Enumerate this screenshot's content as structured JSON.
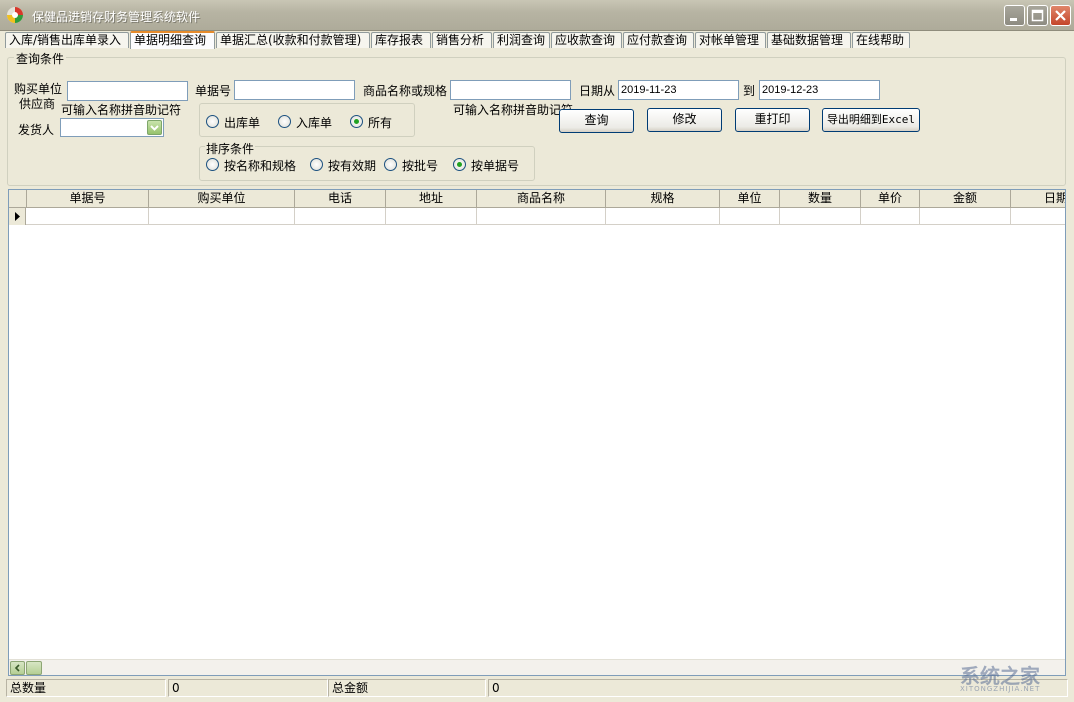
{
  "window": {
    "title": "保健品进销存财务管理系统软件"
  },
  "tabs": [
    {
      "label": "入库/销售出库单录入"
    },
    {
      "label": "单据明细查询"
    },
    {
      "label": "单据汇总(收款和付款管理)"
    },
    {
      "label": "库存报表"
    },
    {
      "label": "销售分析"
    },
    {
      "label": "利润查询"
    },
    {
      "label": "应收款查询"
    },
    {
      "label": "应付款查询"
    },
    {
      "label": "对帐单管理"
    },
    {
      "label": "基础数据管理"
    },
    {
      "label": "在线帮助"
    }
  ],
  "query": {
    "legend": "查询条件",
    "buyer_label": "购买单位",
    "supplier_label": "供应商",
    "pinyin_hint": "可输入名称拼音助记符",
    "buyer_value": "",
    "doc_no_label": "单据号",
    "doc_no_value": "",
    "product_label": "商品名称或规格",
    "product_value": "",
    "product_hint": "可输入名称拼音助记符",
    "date_from_label": "日期从",
    "date_from": "2019-11-23",
    "date_to_label": "到",
    "date_to": "2019-12-23",
    "shipper_label": "发货人",
    "shipper_value": "",
    "doc_type_options": [
      {
        "label": "出库单",
        "checked": false
      },
      {
        "label": "入库单",
        "checked": false
      },
      {
        "label": "所有",
        "checked": true
      }
    ],
    "sort_legend": "排序条件",
    "sort_options": [
      {
        "label": "按名称和规格",
        "checked": false
      },
      {
        "label": "按有效期",
        "checked": false
      },
      {
        "label": "按批号",
        "checked": false
      },
      {
        "label": "按单据号",
        "checked": true
      }
    ],
    "buttons": {
      "search": "查询",
      "edit": "修改",
      "reprint": "重打印",
      "export": "导出明细到Excel"
    }
  },
  "grid": {
    "columns": [
      "单据号",
      "购买单位",
      "电话",
      "地址",
      "商品名称",
      "规格",
      "单位",
      "数量",
      "单价",
      "金额",
      "日期"
    ]
  },
  "status": {
    "total_qty_label": "总数量",
    "total_qty": "0",
    "total_amount_label": "总金额",
    "total_amount": "0"
  },
  "watermark": {
    "text": "系统之家",
    "sub": "XITONGZHIJIA.NET"
  }
}
